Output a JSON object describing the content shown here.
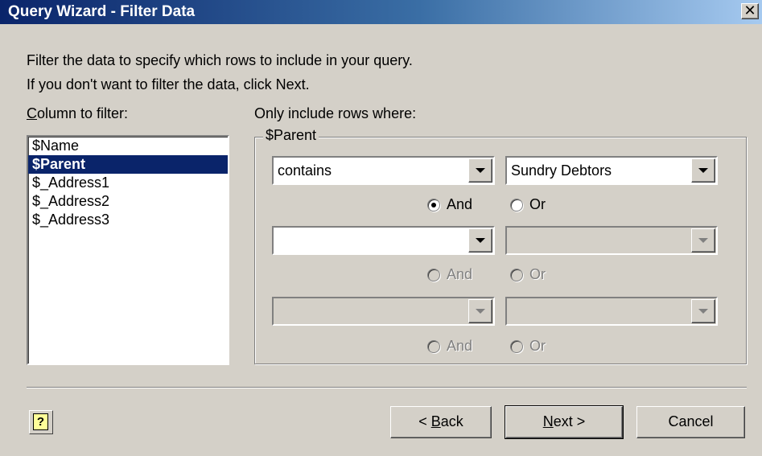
{
  "window": {
    "title": "Query Wizard - Filter Data",
    "close_glyph": "✕"
  },
  "instructions": {
    "line1": "Filter the data to specify which rows to include in your query.",
    "line2": "If you don't want to filter the data, click Next."
  },
  "column_label": {
    "accel": "C",
    "rest": "olumn to filter:"
  },
  "columns": [
    {
      "label": "$Name",
      "selected": false
    },
    {
      "label": "$Parent",
      "selected": true
    },
    {
      "label": "$_Address1",
      "selected": false
    },
    {
      "label": "$_Address2",
      "selected": false
    },
    {
      "label": "$_Address3",
      "selected": false
    }
  ],
  "criteria": {
    "heading": "Only include rows where:",
    "group_title": "$Parent",
    "row1": {
      "operator": "contains",
      "value": "Sundry Debtors",
      "and_label": "And",
      "or_label": "Or",
      "selected": "And"
    },
    "row2": {
      "operator": "",
      "value": "",
      "and_label": "And",
      "or_label": "Or"
    },
    "row3": {
      "operator": "",
      "value": "",
      "and_label": "And",
      "or_label": "Or"
    }
  },
  "buttons": {
    "help_glyph": "?",
    "back": {
      "prefix": "< ",
      "accel": "B",
      "rest": "ack"
    },
    "next": {
      "accel": "N",
      "rest": "ext >"
    },
    "cancel": "Cancel"
  },
  "colors": {
    "face": "#d4d0c8",
    "title_start": "#0a246a",
    "title_end": "#a6caf0",
    "selection": "#0a246a"
  }
}
